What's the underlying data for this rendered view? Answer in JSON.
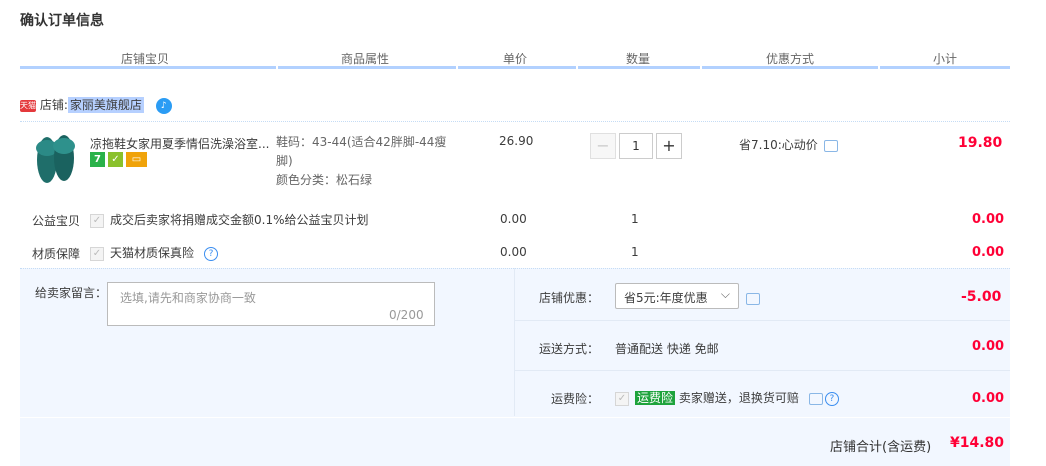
{
  "page_title": "确认订单信息",
  "columns": [
    "店铺宝贝",
    "商品属性",
    "单价",
    "数量",
    "优惠方式",
    "小计"
  ],
  "shop": {
    "badge": "天猫",
    "label": "店铺:",
    "name": "家丽美旗舰店",
    "chat_icon": "wangwang-icon"
  },
  "item": {
    "title": "凉拖鞋女家用夏季情侣洗澡浴室...",
    "attr_size": "鞋码：43-44(适合42胖脚-44瘦",
    "attr_size_cont": "脚)",
    "attr_color": "颜色分类：松石绿",
    "price": "26.90",
    "quantity": "1",
    "qty_minus": "−",
    "qty_plus": "+",
    "discount": "省7.10:心动价",
    "subtotal": "19.80",
    "badge_icons": [
      "7-day-return-icon",
      "guarantee-icon",
      "credit-card-icon"
    ]
  },
  "charity": {
    "label": "公益宝贝",
    "text": "成交后卖家将捐赠成交金额0.1%给公益宝贝计划",
    "price": "0.00",
    "quantity": "1",
    "subtotal": "0.00"
  },
  "material": {
    "label": "材质保障",
    "text": "天猫材质保真险",
    "price": "0.00",
    "quantity": "1",
    "subtotal": "0.00"
  },
  "message": {
    "label": "给卖家留言：",
    "placeholder": "选填,请先和商家协商一致",
    "counter": "0/200"
  },
  "shop_discount": {
    "label": "店铺优惠：",
    "selected": "省5元:年度优惠",
    "amount": "-5.00"
  },
  "shipping": {
    "label": "运送方式：",
    "value": "普通配送 快递 免邮",
    "amount": "0.00"
  },
  "insurance": {
    "label": "运费险：",
    "tag": "运费险",
    "text": "卖家赠送，退换货可赔",
    "amount": "0.00"
  },
  "total": {
    "label": "店铺合计(含运费)",
    "amount": "¥14.80"
  },
  "colors": {
    "accent_red": "#ff0036",
    "header_line": "#b2d1ff",
    "panel_bg": "#f2f7ff"
  }
}
